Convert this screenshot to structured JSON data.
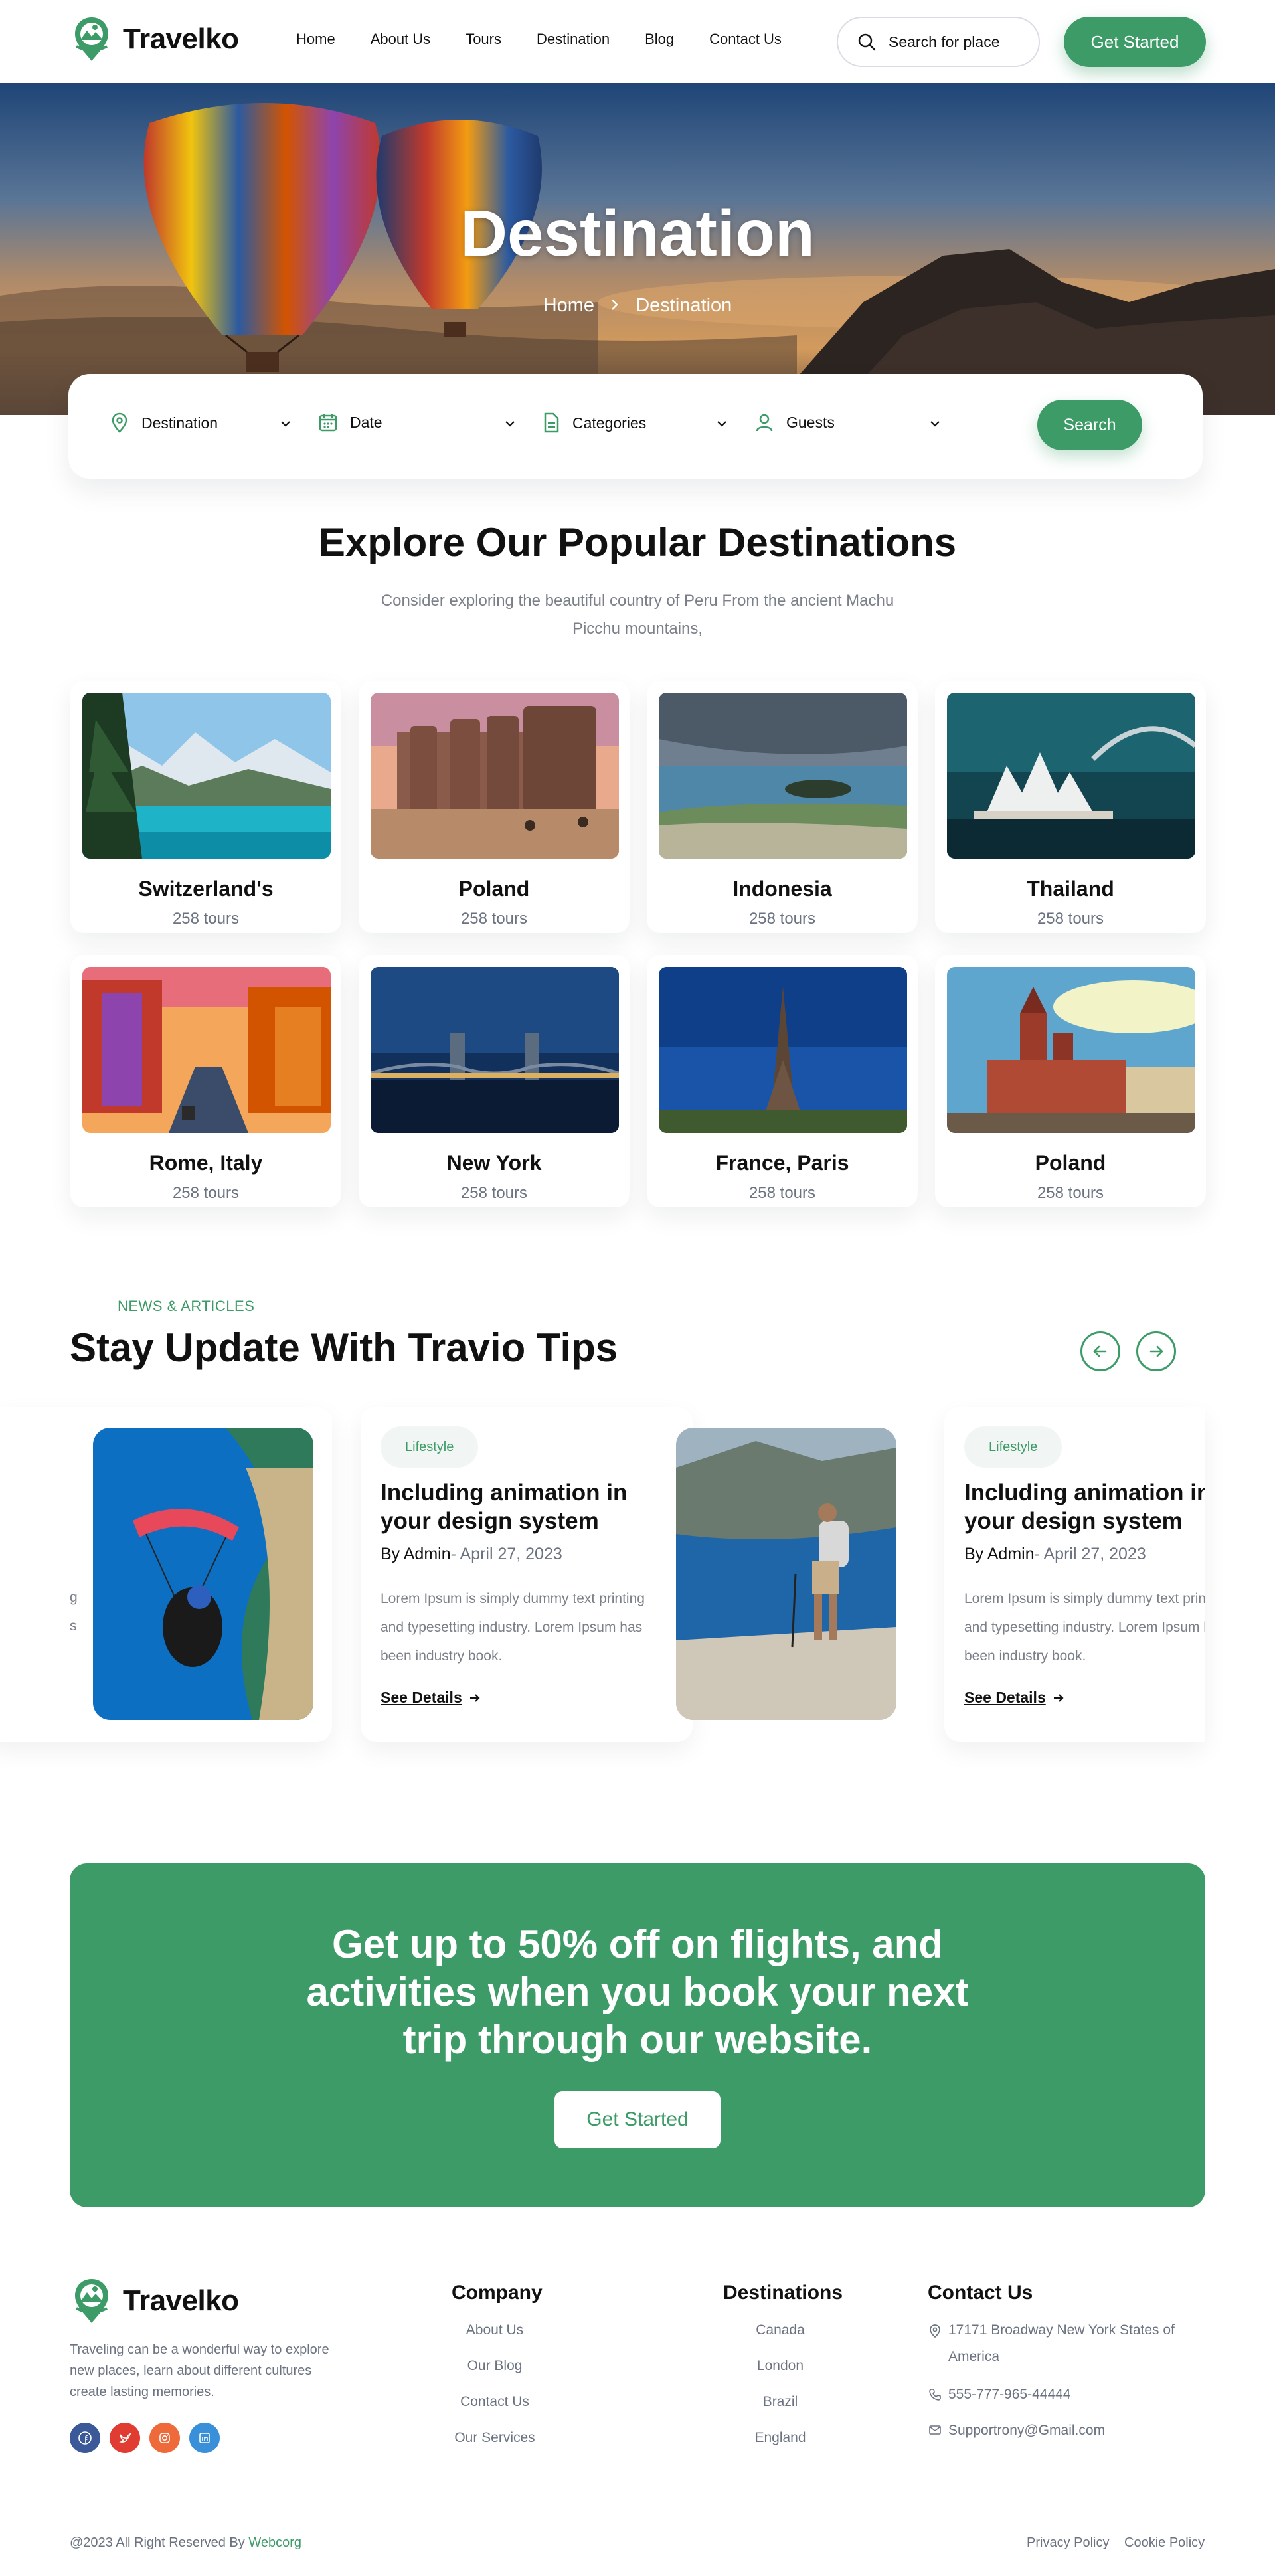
{
  "header": {
    "brand": "Travelko",
    "nav": [
      "Home",
      "About Us",
      "Tours",
      "Destination",
      "Blog",
      "Contact Us"
    ],
    "search_placeholder": "Search for place",
    "cta": "Get Started"
  },
  "hero": {
    "title": "Destination",
    "breadcrumb": [
      "Home",
      "Destination"
    ]
  },
  "booking": {
    "fields": [
      "Destination",
      "Date",
      "Categories",
      "Guests"
    ],
    "search_button": "Search"
  },
  "popular": {
    "title": "Explore Our Popular Destinations",
    "subtitle": "Consider exploring the beautiful country of Peru From the ancient Machu Picchu mountains,",
    "cards": [
      {
        "name": "Switzerland's",
        "count": "258 tours"
      },
      {
        "name": "Poland",
        "count": "258 tours"
      },
      {
        "name": "Indonesia",
        "count": "258 tours"
      },
      {
        "name": "Thailand",
        "count": "258 tours"
      },
      {
        "name": "Rome, Italy",
        "count": "258 tours"
      },
      {
        "name": "New York",
        "count": "258 tours"
      },
      {
        "name": "France, Paris",
        "count": "258 tours"
      },
      {
        "name": "Poland",
        "count": "258 tours"
      }
    ]
  },
  "tips": {
    "eyebrow": "NEWS & ARTICLES",
    "title": "Stay Update With Travio Tips",
    "clipped_left": [
      "g",
      "s"
    ],
    "posts": [
      {
        "tag": "Lifestyle",
        "title": "Including animation in your design system",
        "author": "By Admin",
        "date": "- April 27, 2023",
        "excerpt": "Lorem Ipsum is simply dummy text printing and typesetting industry. Lorem Ipsum has been industry book.",
        "link": "See Details"
      },
      {
        "tag": "Lifestyle",
        "title": "Including animation in your design system",
        "author": "By Admin",
        "date": "- April 27, 2023",
        "excerpt": "Lorem Ipsum is simply dummy text printing and typesetting industry. Lorem Ipsum has been industry book.",
        "link": "See Details"
      }
    ]
  },
  "promo": {
    "text": "Get up to 50% off on flights, and activities when you book your next trip through our website.",
    "cta": "Get Started"
  },
  "footer": {
    "brand": "Travelko",
    "about": "Traveling can be a wonderful way to explore new places, learn about different cultures create lasting memories.",
    "company": {
      "title": "Company",
      "links": [
        "About Us",
        "Our Blog",
        "Contact Us",
        "Our Services"
      ]
    },
    "destinations": {
      "title": "Destinations",
      "links": [
        "Canada",
        "London",
        "Brazil",
        "England"
      ]
    },
    "contact": {
      "title": "Contact Us",
      "address": "17171 Broadway New York States of America",
      "phone": "555-777-965-44444",
      "email": "Supportrony@Gmail.com"
    },
    "copyright_prefix": "@2023 All Right Reserved By ",
    "copyright_link": "Webcorg",
    "legal": [
      "Privacy Policy",
      "Cookie Policy"
    ]
  },
  "colors": {
    "accent": "#3c9b67",
    "text": "#111111",
    "muted": "#7a7f88"
  },
  "icons": [
    "logo-icon",
    "search-icon",
    "location-icon",
    "calendar-icon",
    "document-icon",
    "user-icon",
    "chevron-down-icon",
    "chevron-right-icon",
    "arrow-left-icon",
    "arrow-right-icon",
    "facebook-icon",
    "twitter-icon",
    "instagram-icon",
    "linkedin-icon",
    "phone-icon",
    "mail-icon"
  ]
}
